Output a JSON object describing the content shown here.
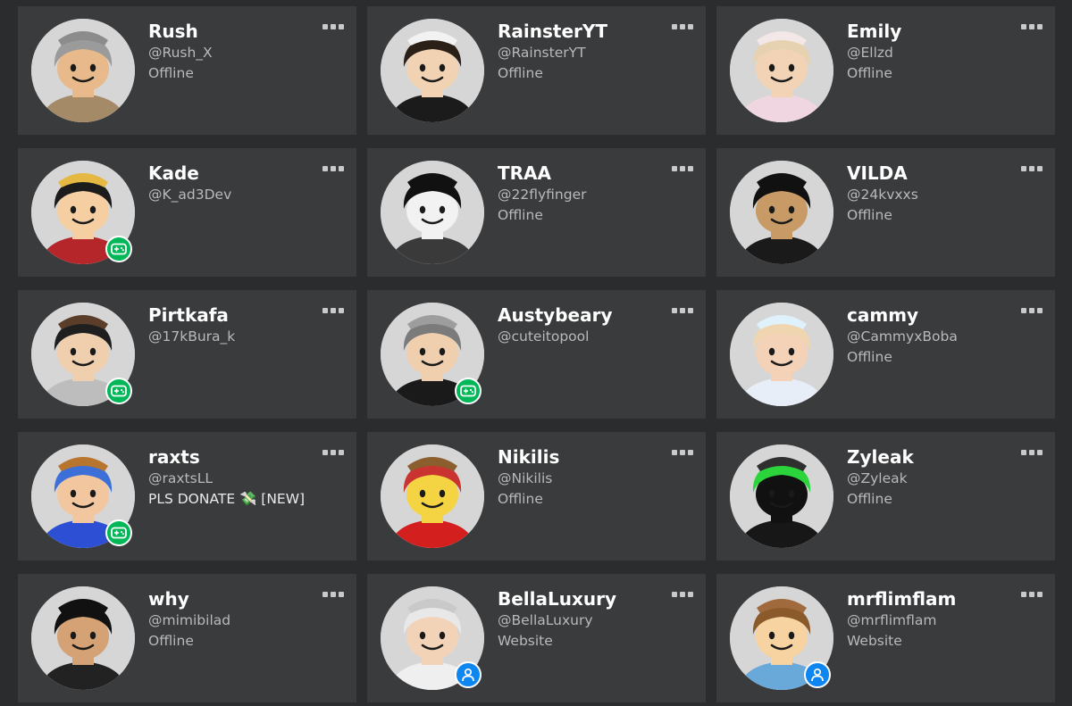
{
  "friends": [
    {
      "name": "",
      "handle": "",
      "status": "",
      "badge": "none",
      "skin": "#f0c89a",
      "hair": "#444444",
      "hat": "#888888",
      "shirt": "#555555"
    },
    {
      "name": "",
      "handle": "",
      "status": "",
      "badge": "none",
      "skin": "#f0c89a",
      "hair": "#444444",
      "hat": "#888888",
      "shirt": "#555555"
    },
    {
      "name": "",
      "handle": "",
      "status": "",
      "badge": "none",
      "skin": "#f0c89a",
      "hair": "#444444",
      "hat": "#888888",
      "shirt": "#555555"
    },
    {
      "name": "Rush",
      "handle": "@Rush_X",
      "status": "Offline",
      "badge": "none",
      "skin": "#e8b98a",
      "hair": "#9b9b9b",
      "hat": "#8c8c8c",
      "shirt": "#a58a67"
    },
    {
      "name": "RainsterYT",
      "handle": "@RainsterYT",
      "status": "Offline",
      "badge": "none",
      "skin": "#f1d3b3",
      "hair": "#2b2018",
      "hat": "#f2f2f2",
      "shirt": "#1b1b1b"
    },
    {
      "name": "Emily",
      "handle": "@Ellzd",
      "status": "Offline",
      "badge": "none",
      "skin": "#f3d3b6",
      "hair": "#e6d2b0",
      "hat": "#f4e7e7",
      "shirt": "#efd6e0"
    },
    {
      "name": "Kade",
      "handle": "@K_ad3Dev",
      "status": "",
      "badge": "game",
      "skin": "#f5cfa2",
      "hair": "#1c1c1c",
      "hat": "#e5b843",
      "shirt": "#b4262a"
    },
    {
      "name": "TRAA",
      "handle": "@22flyfinger",
      "status": "Offline",
      "badge": "none",
      "skin": "#f2f2f2",
      "hair": "#111111",
      "hat": "#111111",
      "shirt": "#3a3a3a"
    },
    {
      "name": "VILDA",
      "handle": "@24kvxxs",
      "status": "Offline",
      "badge": "none",
      "skin": "#c89a66",
      "hair": "#111111",
      "hat": "#111111",
      "shirt": "#1a1a1a"
    },
    {
      "name": "Pirtkafa",
      "handle": "@17kBura_k",
      "status": "",
      "badge": "game",
      "skin": "#f0cfae",
      "hair": "#1f1f1f",
      "hat": "#5a3e2a",
      "shirt": "#bdbdbd"
    },
    {
      "name": "Austybeary",
      "handle": "@cuteitopool",
      "status": "",
      "badge": "game",
      "skin": "#f0cfae",
      "hair": "#7b7b7b",
      "hat": "#9d9d9d",
      "shirt": "#1a1a1a"
    },
    {
      "name": "cammy",
      "handle": "@CammyxBoba",
      "status": "Offline",
      "badge": "none",
      "skin": "#f4d2b8",
      "hair": "#f0d6b0",
      "hat": "#dff1fb",
      "shirt": "#e7eef7"
    },
    {
      "name": "raxts",
      "handle": "@raxtsLL",
      "status": "PLS DONATE 💸 [NEW]",
      "badge": "game",
      "skin": "#f2c79f",
      "hair": "#3d6fd9",
      "hat": "#b7752e",
      "shirt": "#2c4fd3"
    },
    {
      "name": "Nikilis",
      "handle": "@Nikilis",
      "status": "Offline",
      "badge": "none",
      "skin": "#f5d444",
      "hair": "#c93431",
      "hat": "#8a5f2d",
      "shirt": "#d41f1f"
    },
    {
      "name": "Zyleak",
      "handle": "@Zyleak",
      "status": "Offline",
      "badge": "none",
      "skin": "#111111",
      "hair": "#2bd43b",
      "hat": "#2f2f2f",
      "shirt": "#171717"
    },
    {
      "name": "why",
      "handle": "@mimibilad",
      "status": "Offline",
      "badge": "none",
      "skin": "#d4a274",
      "hair": "#111111",
      "hat": "#111111",
      "shirt": "#222222"
    },
    {
      "name": "BellaLuxury",
      "handle": "@BellaLuxury",
      "status": "Website",
      "badge": "web",
      "skin": "#f3d3b8",
      "hair": "#e8e8e8",
      "hat": "#c9c9c9",
      "shirt": "#efefef"
    },
    {
      "name": "mrflimflam",
      "handle": "@mrflimflam",
      "status": "Website",
      "badge": "web",
      "skin": "#f6d3a1",
      "hair": "#8b5a2b",
      "hat": "#a06a3c",
      "shirt": "#69a9d9"
    }
  ],
  "icons": {
    "more": "more-options-icon",
    "game": "gamepad-icon",
    "web": "website-user-icon"
  },
  "colors": {
    "page_bg": "#2b2c2e",
    "card_bg": "#393b3d",
    "name": "#ffffff",
    "secondary": "#b8b9ba",
    "game_badge": "#02b757",
    "web_badge": "#0e86f0"
  }
}
